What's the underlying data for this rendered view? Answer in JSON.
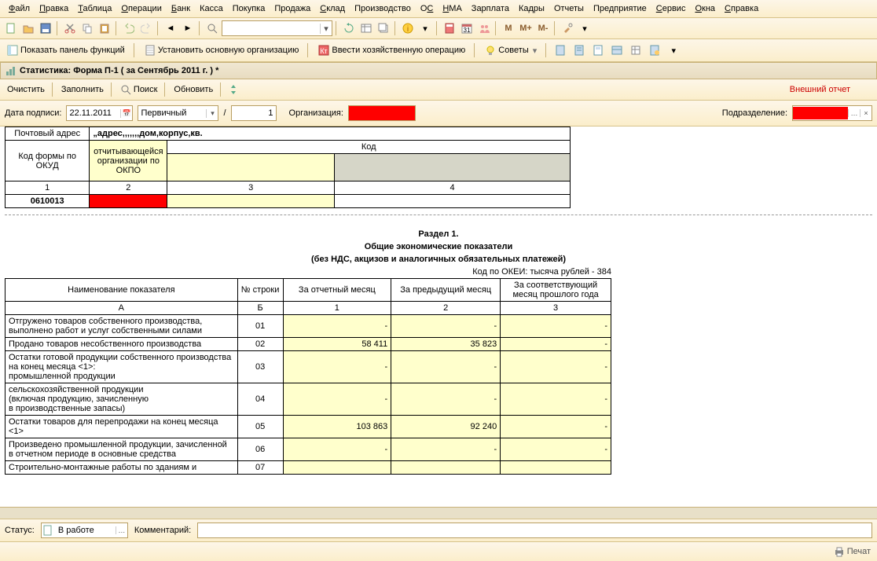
{
  "menu": [
    "Файл",
    "Правка",
    "Таблица",
    "Операции",
    "Банк",
    "Касса",
    "Покупка",
    "Продажа",
    "Склад",
    "Производство",
    "ОС",
    "НМА",
    "Зарплата",
    "Кадры",
    "Отчеты",
    "Предприятие",
    "Сервис",
    "Окна",
    "Справка"
  ],
  "menu_underline": [
    0,
    0,
    0,
    0,
    0,
    -1,
    -1,
    -1,
    0,
    -1,
    1,
    0,
    -1,
    -1,
    -1,
    -1,
    0,
    0,
    0
  ],
  "actionbar": {
    "show_panel": "Показать панель функций",
    "set_org": "Установить основную организацию",
    "enter_op": "Ввести хозяйственную операцию",
    "tips": "Советы"
  },
  "m_buttons": [
    "M",
    "M+",
    "M-"
  ],
  "title": "Статистика: Форма П-1 ( за Сентябрь 2011 г. ) *",
  "doc_toolbar": {
    "clear": "Очистить",
    "fill": "Заполнить",
    "search": "Поиск",
    "refresh": "Обновить",
    "ext_report": "Внешний отчет"
  },
  "filter": {
    "date_label": "Дата подписи:",
    "date_value": "22.11.2011",
    "type_value": "Первичный",
    "slash_value": "1",
    "org_label": "Организация:",
    "dept_label": "Подразделение:"
  },
  "header_table": {
    "addr_label": "Почтовый адрес",
    "addr_value": "„адрес,,,,,,,дом,корпус,кв.",
    "code_label": "Код",
    "okud_label": "Код формы по ОКУД",
    "okpo_label": "отчитывающейся организации по ОКПО",
    "cols": [
      "1",
      "2",
      "3",
      "4"
    ],
    "okud_value": "0610013"
  },
  "section": {
    "line1": "Раздел 1.",
    "line2": "Общие экономические показатели",
    "line3": "(без НДС, акцизов и аналогичных обязательных платежей)"
  },
  "okei": "Код по ОКЕИ: тысяча рублей - 384",
  "table_headers": {
    "name": "Наименование показателя",
    "row_no": "№ строки",
    "col1": "За отчетный месяц",
    "col2": "За предыдущий месяц",
    "col3": "За соответствующий месяц прошлого года",
    "sub": [
      "А",
      "Б",
      "1",
      "2",
      "3"
    ]
  },
  "rows": [
    {
      "name": "Отгружено товаров собственного производства, выполнено работ и услуг собственными силами",
      "no": "01",
      "v1": "-",
      "v2": "-",
      "v3": "-"
    },
    {
      "name": "Продано товаров несобственного производства",
      "no": "02",
      "v1": "58 411",
      "v2": "35 823",
      "v3": "-"
    },
    {
      "name": "Остатки готовой продукции собственного производства на конец месяца <1>:\n    промышленной продукции",
      "no": "03",
      "v1": "-",
      "v2": "-",
      "v3": "-"
    },
    {
      "name": "    сельскохозяйственной продукции\n    (включая продукцию, зачисленную\n    в производственные запасы)",
      "no": "04",
      "v1": "-",
      "v2": "-",
      "v3": "-"
    },
    {
      "name": "Остатки товаров для перепродажи на конец месяца <1>",
      "no": "05",
      "v1": "103 863",
      "v2": "92 240",
      "v3": "-"
    },
    {
      "name": "Произведено промышленной продукции, зачисленной в отчетном периоде в основные средства",
      "no": "06",
      "v1": "-",
      "v2": "-",
      "v3": "-"
    },
    {
      "name": "Строительно-монтажные работы по зданиям и",
      "no": "07",
      "v1": "",
      "v2": "",
      "v3": ""
    }
  ],
  "status": {
    "label": "Статус:",
    "value": "В работе",
    "comment_label": "Комментарий:"
  },
  "footer": {
    "print": "Печат"
  }
}
